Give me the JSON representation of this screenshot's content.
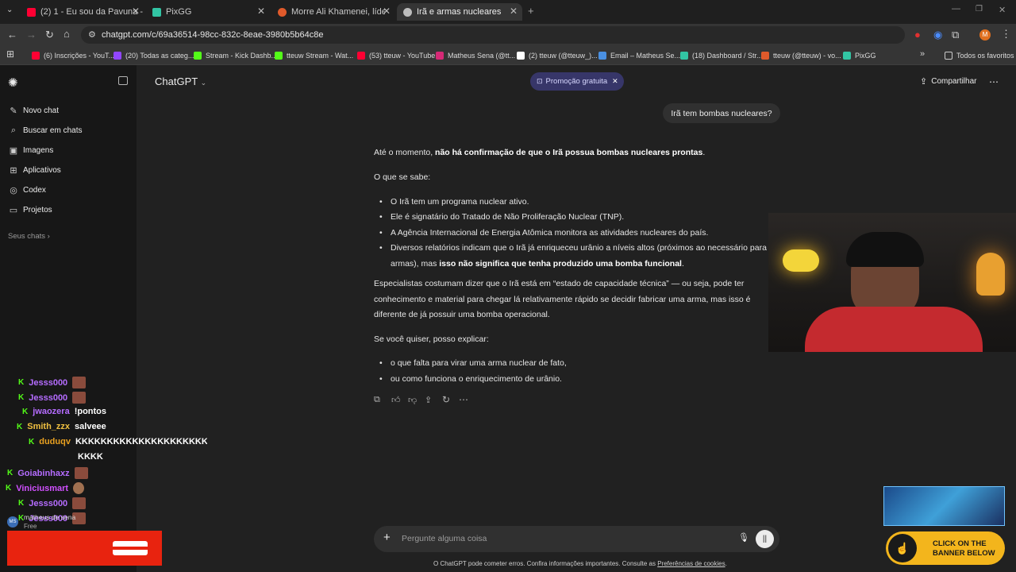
{
  "tabs": [
    {
      "title": "(2) 1 - Eu sou da Pavuna - Bebe",
      "color": "#ff0033"
    },
    {
      "title": "PixGG",
      "color": "#32c5a4"
    },
    {
      "title": "Morre Ali Khamenei, líder do Irã",
      "color": "#e05a2b"
    },
    {
      "title": "Irã e armas nucleares",
      "color": "#bdbdbd"
    }
  ],
  "address": {
    "url": "chatgpt.com/c/69a36514-98cc-832c-8eae-3980b5b64c8e"
  },
  "bookmarks": [
    {
      "label": "(6) Inscrições - YouT...",
      "color": "#ff0033"
    },
    {
      "label": "(20) Todas as categ...",
      "color": "#9146ff"
    },
    {
      "label": "Stream - Kick Dashb...",
      "color": "#53fc18"
    },
    {
      "label": "tteuw Stream - Wat...",
      "color": "#53fc18"
    },
    {
      "label": "(53) tteuw - YouTube",
      "color": "#ff0033"
    },
    {
      "label": "Matheus Sena (@tt...",
      "color": "#d62976"
    },
    {
      "label": "(2) tteuw (@tteuw_)...",
      "color": "#ffffff"
    },
    {
      "label": "Email – Matheus Se...",
      "color": "#4a90e2"
    },
    {
      "label": "(18) Dashboard / Str...",
      "color": "#32c5a4"
    },
    {
      "label": "tteuw (@tteuw) - vo...",
      "color": "#e05a2b"
    },
    {
      "label": "PixGG",
      "color": "#32c5a4"
    }
  ],
  "all_bookmarks": "Todos os favoritos",
  "sidebar": {
    "items": [
      {
        "label": "Novo chat",
        "icon": "edit-icon",
        "glyph": "✎"
      },
      {
        "label": "Buscar em chats",
        "icon": "search-icon",
        "glyph": "⌕"
      },
      {
        "label": "Imagens",
        "icon": "image-icon",
        "glyph": "▣"
      },
      {
        "label": "Aplicativos",
        "icon": "apps-icon",
        "glyph": "⊞"
      },
      {
        "label": "Codex",
        "icon": "codex-icon",
        "glyph": "◎"
      },
      {
        "label": "Projetos",
        "icon": "folder-icon",
        "glyph": "▭"
      }
    ],
    "your_chats": "Seus chats ›"
  },
  "header": {
    "model": "ChatGPT",
    "promo": "Promoção gratuita",
    "share": "Compartilhar"
  },
  "user_message": "Irã tem bombas nucleares?",
  "answer": {
    "p1_plain": "Até o momento, ",
    "p1_bold": "não há confirmação de que o Irã possua bombas nucleares prontas",
    "p1_end": ".",
    "p2": "O que se sabe:",
    "bullets1": [
      "O Irã tem um programa nuclear ativo.",
      "Ele é signatário do Tratado de Não Proliferação Nuclear (TNP).",
      "A Agência Internacional de Energia Atômica monitora as atividades nucleares do país."
    ],
    "b4_line1": "Diversos relatórios indicam que o Irã já enriqueceu urânio a níveis altos (próximos ao necessário para",
    "b4_line2_plain": "armas), mas ",
    "b4_line2_bold": "isso não significa que tenha produzido uma bomba funcional",
    "b4_line2_end": ".",
    "p3_l1": "Especialistas costumam dizer que o Irã está em “estado de capacidade técnica” — ou seja, pode ter",
    "p3_l2": "conhecimento e material para chegar lá relativamente rápido se decidir fabricar uma arma, mas isso é",
    "p3_l3": "diferente de já possuir uma bomba operacional.",
    "p4": "Se você quiser, posso explicar:",
    "bullets2": [
      "o que falta para virar uma arma nuclear de fato,",
      "ou como funciona o enriquecimento de urânio."
    ]
  },
  "composer": {
    "placeholder": "Pergunte alguma coisa",
    "disclaimer": "O ChatGPT pode cometer erros. Confira informações importantes. Consulte as ",
    "cookies_link": "Preferências de cookies",
    "disclaimer_end": "."
  },
  "chat_overlay": [
    {
      "user": "Jesss000",
      "color": "#b56cff",
      "message": "",
      "emote": true
    },
    {
      "user": "Jesss000",
      "color": "#b56cff",
      "message": "",
      "emote": true
    },
    {
      "user": "jwaozera",
      "color": "#b56cff",
      "message": "!pontos",
      "emote": false
    },
    {
      "user": "Smith_zzx",
      "color": "#f0c040",
      "message": "salveee",
      "emote": false
    },
    {
      "user": "duduqv",
      "color": "#e8a020",
      "message": "KKKKKKKKKKKKKKKKKKKKKKK",
      "emote": false
    },
    {
      "user": "",
      "color": "#ffffff",
      "message": "KKKK",
      "emote": false
    },
    {
      "user": "Goiabinhaxz",
      "color": "#b56cff",
      "message": "",
      "emote": true
    },
    {
      "user": "Viniciusmart",
      "color": "#d050ff",
      "message": "",
      "emote": true
    },
    {
      "user": "Jesss000",
      "color": "#b56cff",
      "message": "",
      "emote": true
    },
    {
      "user": "Jesss000",
      "color": "#b56cff",
      "message": "",
      "emote": true
    }
  ],
  "account": {
    "initials": "MS",
    "name": "matheus de sena",
    "plan": "Free"
  },
  "promo_banner": {
    "line1": "CLICK ON THE",
    "line2": "BANNER BELOW"
  }
}
